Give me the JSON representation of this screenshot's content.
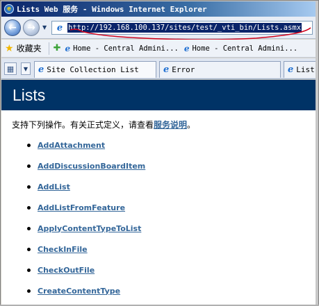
{
  "window": {
    "title": "Lists Web 服务 - Windows Internet Explorer",
    "title_icon": "ie-icon"
  },
  "address_bar": {
    "url": "http://192.168.100.137/sites/test/_vti_bin/Lists.asmx",
    "annotation_color": "#d0021b"
  },
  "favorites_bar": {
    "label": "收藏夹",
    "items": [
      "Home - Central Admini...",
      "Home - Central Admini..."
    ]
  },
  "tabs": [
    {
      "label": "Site Collection List"
    },
    {
      "label": "Error"
    },
    {
      "label": "List"
    }
  ],
  "page": {
    "banner_title": "Lists",
    "banner_color": "#003366",
    "intro_text": "支持下列操作。有关正式定义，请查看",
    "intro_link": "服务说明",
    "intro_end": "。",
    "link_color": "#336699",
    "operations": [
      "AddAttachment",
      "AddDiscussionBoardItem",
      "AddList",
      "AddListFromFeature",
      "ApplyContentTypeToList",
      "CheckInFile",
      "CheckOutFile",
      "CreateContentType"
    ]
  }
}
